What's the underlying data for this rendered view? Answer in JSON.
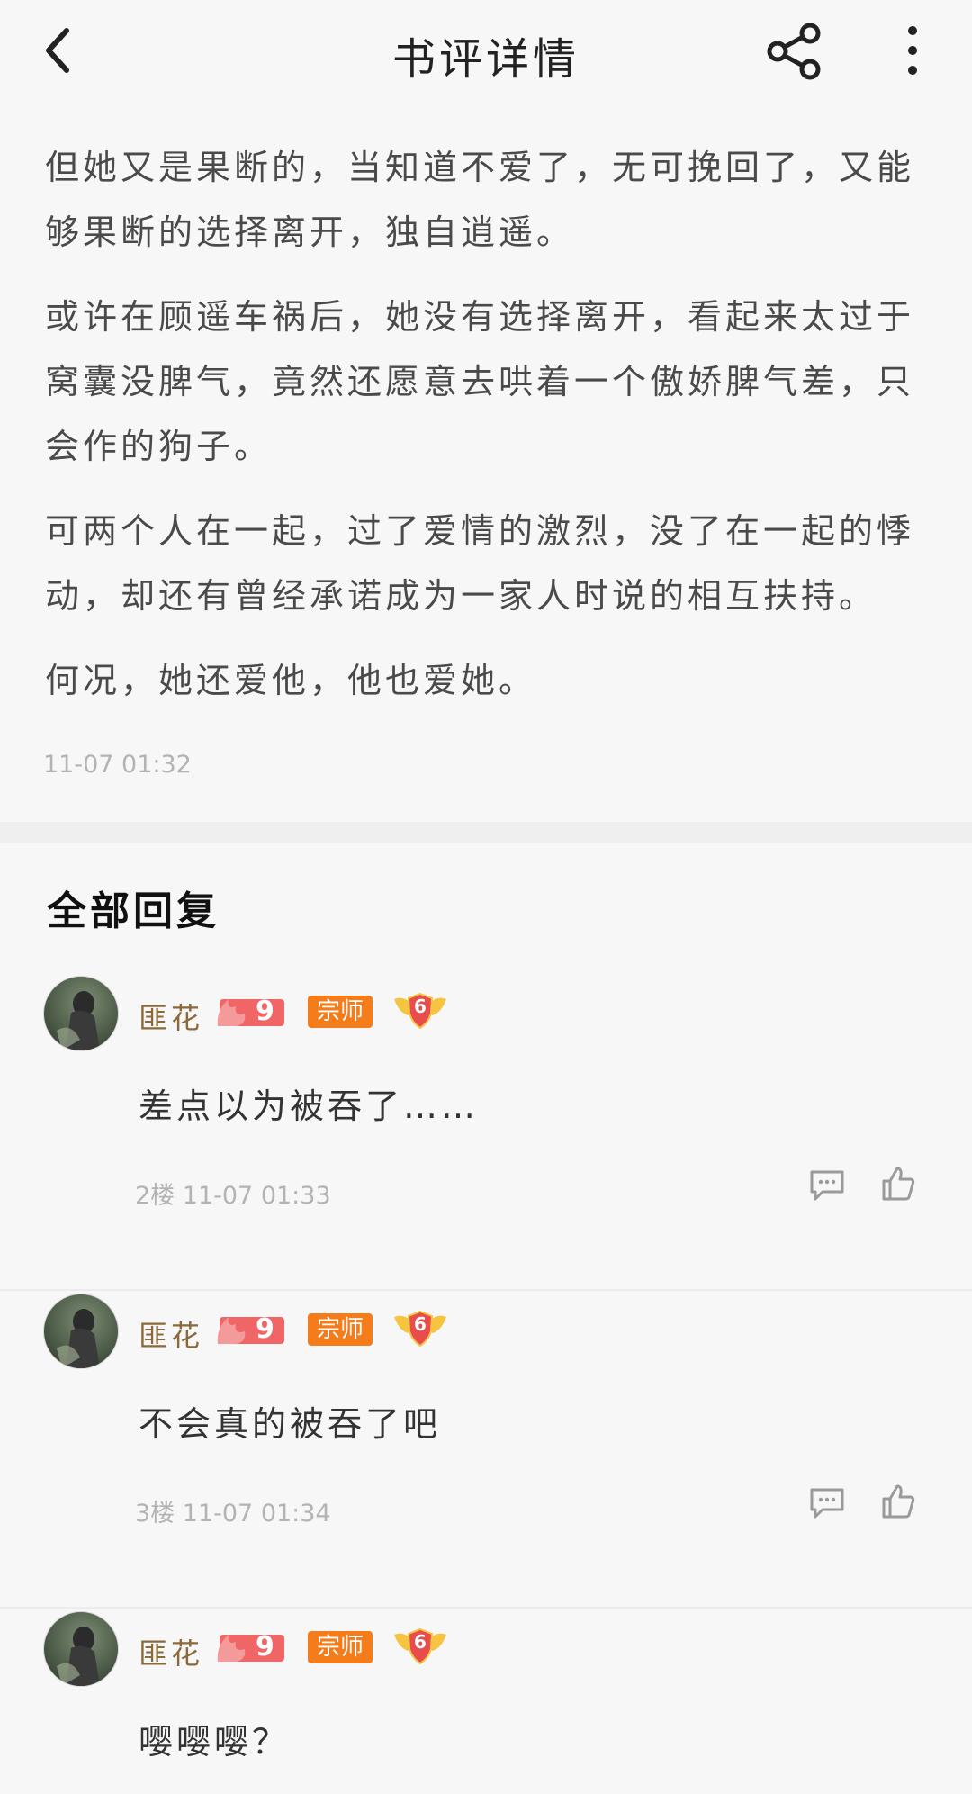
{
  "header": {
    "title": "书评详情"
  },
  "article": {
    "paragraphs": [
      "但她又是果断的，当知道不爱了，无可挽回了，又能够果断的选择离开，独自逍遥。",
      "或许在顾遥车祸后，她没有选择离开，看起来太过于窝囊没脾气，竟然还愿意去哄着一个傲娇脾气差，只会作的狗子。",
      "可两个人在一起，过了爱情的激烈，没了在一起的悸动，却还有曾经承诺成为一家人时说的相互扶持。",
      "何况，她还爱他，他也爱她。"
    ],
    "time": "11-07 01:32"
  },
  "section_title": "全部回复",
  "replies": [
    {
      "username": "匪花",
      "fire_level": "9",
      "rank": "宗师",
      "level": "6",
      "text": "差点以为被吞了……",
      "floor": "2楼",
      "time": "11-07 01:33"
    },
    {
      "username": "匪花",
      "fire_level": "9",
      "rank": "宗师",
      "level": "6",
      "text": "不会真的被吞了吧",
      "floor": "3楼",
      "time": "11-07 01:34"
    },
    {
      "username": "匪花",
      "fire_level": "9",
      "rank": "宗师",
      "level": "6",
      "text": "嘤嘤嘤？",
      "floor": "",
      "time": ""
    }
  ],
  "colors": {
    "username": "#8a6a3a",
    "rank_badge": "#f47c1a",
    "fire_badge": "#f06666",
    "level_badge": "#f0b429",
    "meta": "#b3b3b3"
  }
}
